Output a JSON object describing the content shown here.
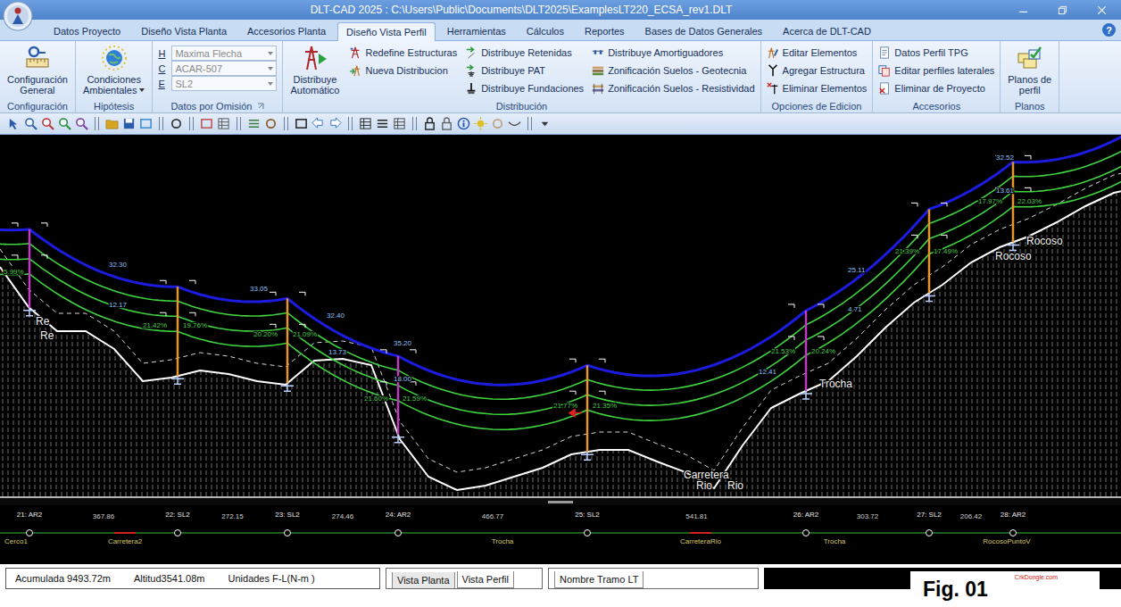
{
  "window": {
    "title": "DLT-CAD 2025 : C:\\Users\\Public\\Documents\\DLT2025\\ExamplesLT220_ECSA_rev1.DLT",
    "help": "?"
  },
  "tabs": [
    {
      "label": "Datos Proyecto",
      "selected": false
    },
    {
      "label": "Diseño Vista Planta",
      "selected": false
    },
    {
      "label": "Accesorios Planta",
      "selected": false
    },
    {
      "label": "Diseño Vista Perfil",
      "selected": true
    },
    {
      "label": "Herramientas",
      "selected": false
    },
    {
      "label": "Cálculos",
      "selected": false
    },
    {
      "label": "Reportes",
      "selected": false
    },
    {
      "label": "Bases de Datos Generales",
      "selected": false
    },
    {
      "label": "Acerca de DLT-CAD",
      "selected": false
    }
  ],
  "ribbon": {
    "configuracion": {
      "label": "Configuración",
      "button": [
        "Configuración",
        "General"
      ]
    },
    "hipotesis": {
      "label": "Hipótesis",
      "button": [
        "Condiciones",
        "Ambientales"
      ]
    },
    "datos": {
      "label": "Datos por Omisión",
      "combos": [
        {
          "key": "H",
          "value": "Maxima Flecha",
          "disabled": true
        },
        {
          "key": "C",
          "value": "ACAR-507",
          "disabled": true
        },
        {
          "key": "E",
          "value": "SL2",
          "disabled": true
        }
      ]
    },
    "distribucion": {
      "label": "Distribución",
      "button": [
        "Distribuye",
        "Automático"
      ],
      "columns": [
        [
          "Redefine Estructuras",
          "Nueva Distribucion"
        ],
        [
          "Distribuye Retenidas",
          "Distribuye PAT",
          "Distribuye Fundaciones"
        ],
        [
          "Distribuye Amortiguadores",
          "Zonificación Suelos - Geotecnia",
          "Zonificación Suelos - Resistividad"
        ]
      ]
    },
    "edicion": {
      "label": "Opciones de Edicion",
      "items": [
        "Editar Elementos",
        "Agregar Estructura",
        "Eliminar Elementos"
      ]
    },
    "accesorios": {
      "label": "Accesorios",
      "items": [
        "Datos Perfil TPG",
        "Editar perfiles laterales",
        "Eliminar de Proyecto"
      ]
    },
    "planos": {
      "label": "Planos",
      "button": [
        "Planos de",
        "perfil"
      ]
    }
  },
  "profile": {
    "ground": [
      257,
      212,
      185,
      185,
      165,
      129,
      133,
      141,
      137,
      129,
      125,
      152,
      154,
      147,
      64,
      22,
      7,
      12,
      22,
      32,
      47,
      52,
      52,
      39,
      27,
      9,
      57,
      99,
      115,
      129,
      157,
      189,
      217,
      237,
      262,
      279,
      291,
      307,
      325,
      340,
      347
    ],
    "wire_ends": [
      305,
      430
    ],
    "towers": [
      {
        "name": "21: AR2",
        "station": 33,
        "height": 88,
        "color": "#c23ac4",
        "marker": false
      },
      {
        "name": "22: SL2",
        "station": 199,
        "height": 100,
        "color": "#e8952c",
        "marker": false
      },
      {
        "name": "23: SL2",
        "station": 322,
        "height": 95,
        "color": "#e8952c",
        "marker": false
      },
      {
        "name": "24: AR2",
        "station": 446,
        "height": 88,
        "color": "#c23ac4",
        "marker": false
      },
      {
        "name": "25: SL2",
        "station": 658,
        "height": 97,
        "color": "#e8952c",
        "marker": true
      },
      {
        "name": "26: AR2",
        "station": 903,
        "height": 90,
        "color": "#c23ac4",
        "marker": false
      },
      {
        "name": "27: SL2",
        "station": 1041,
        "height": 94,
        "color": "#e8952c",
        "marker": false
      },
      {
        "name": "28: AR2",
        "station": 1135,
        "height": 90,
        "color": "#e8952c",
        "marker": false
      }
    ],
    "annotations": [
      {
        "text": "5.99%",
        "kind": "percent",
        "station": 4,
        "elevation": 249
      },
      {
        "text": "32.30",
        "kind": "value",
        "station": 122,
        "elevation": 257
      },
      {
        "text": "12.17",
        "kind": "value",
        "station": 122,
        "elevation": 212
      },
      {
        "text": "21.42%",
        "kind": "percent",
        "station": 160,
        "elevation": 189
      },
      {
        "text": "19.76%",
        "kind": "percent",
        "station": 205,
        "elevation": 189
      },
      {
        "text": "33.05",
        "kind": "value",
        "station": 280,
        "elevation": 230
      },
      {
        "text": "20.20%",
        "kind": "percent",
        "station": 284,
        "elevation": 179
      },
      {
        "text": "21.09%",
        "kind": "percent",
        "station": 328,
        "elevation": 179
      },
      {
        "text": "32.40",
        "kind": "value",
        "station": 366,
        "elevation": 200
      },
      {
        "text": "13.73",
        "kind": "value",
        "station": 368,
        "elevation": 159
      },
      {
        "text": "35.20",
        "kind": "value",
        "station": 441,
        "elevation": 169
      },
      {
        "text": "18.00",
        "kind": "value",
        "station": 441,
        "elevation": 129
      },
      {
        "text": "21.60%",
        "kind": "percent",
        "station": 408,
        "elevation": 107
      },
      {
        "text": "21.59%",
        "kind": "percent",
        "station": 451,
        "elevation": 107
      },
      {
        "text": "21.77%",
        "kind": "percent",
        "station": 620,
        "elevation": 99
      },
      {
        "text": "21.35%",
        "kind": "percent",
        "station": 664,
        "elevation": 99
      },
      {
        "text": "12.41",
        "kind": "value",
        "station": 850,
        "elevation": 137
      },
      {
        "text": "21.53%",
        "kind": "percent",
        "station": 864,
        "elevation": 160
      },
      {
        "text": "20.24%",
        "kind": "percent",
        "station": 909,
        "elevation": 160
      },
      {
        "text": "25.11",
        "kind": "value",
        "station": 950,
        "elevation": 251
      },
      {
        "text": "4.71",
        "kind": "value",
        "station": 950,
        "elevation": 207
      },
      {
        "text": "21.39%",
        "kind": "percent",
        "station": 1003,
        "elevation": 272
      },
      {
        "text": "17.49%",
        "kind": "percent",
        "station": 1046,
        "elevation": 272
      },
      {
        "text": "32.52",
        "kind": "value",
        "station": 1116,
        "elevation": 377
      },
      {
        "text": "13.61",
        "kind": "value",
        "station": 1116,
        "elevation": 340
      },
      {
        "text": "17.97%",
        "kind": "percent",
        "station": 1096,
        "elevation": 328
      },
      {
        "text": "22.03%",
        "kind": "percent",
        "station": 1140,
        "elevation": 328
      },
      {
        "text": "Re",
        "kind": "terrain",
        "station": 40,
        "elevation": 192
      },
      {
        "text": "Re",
        "kind": "terrain",
        "station": 45,
        "elevation": 176
      },
      {
        "text": "Trocha",
        "kind": "terrain",
        "station": 918,
        "elevation": 122
      },
      {
        "text": "Rocoso",
        "kind": "terrain",
        "station": 1150,
        "elevation": 282
      },
      {
        "text": "Rocoso",
        "kind": "terrain",
        "station": 1115,
        "elevation": 265
      },
      {
        "text": "Carretera",
        "kind": "terrain",
        "station": 766,
        "elevation": 20
      },
      {
        "text": "Rio",
        "kind": "terrain",
        "station": 780,
        "elevation": 8
      },
      {
        "text": "Rio",
        "kind": "terrain",
        "station": 815,
        "elevation": 8
      }
    ]
  },
  "strip": {
    "spans": [
      "367.86",
      "272.15",
      "274.46",
      "466.77",
      "541.81",
      "303.72",
      "206.42"
    ],
    "zones": [
      {
        "text": "Cerco1",
        "station": 18,
        "road": false
      },
      {
        "text": "Carretera2",
        "station": 140,
        "road": true
      },
      {
        "text": "Trocha",
        "station": 563,
        "road": false
      },
      {
        "text": "CarreteraRio",
        "station": 785,
        "road": true
      },
      {
        "text": "Trocha",
        "station": 935,
        "road": false
      },
      {
        "text": "RocosoPuntoV",
        "station": 1128,
        "road": false
      }
    ]
  },
  "status_bar": {
    "fields": [
      "Acumulada 9493.72m",
      "Altitud3541.08m",
      "Unidades F-L(N-m )"
    ],
    "view_tabs": [
      {
        "label": "Vista Planta",
        "selected": false
      },
      {
        "label": "Vista Perfil",
        "selected": true
      }
    ],
    "section_tabs": [
      {
        "label": "Nombre Tramo LT",
        "selected": true
      }
    ]
  },
  "figure": {
    "caption": "Fig. 01",
    "watermark": "CrkDongle.com"
  }
}
